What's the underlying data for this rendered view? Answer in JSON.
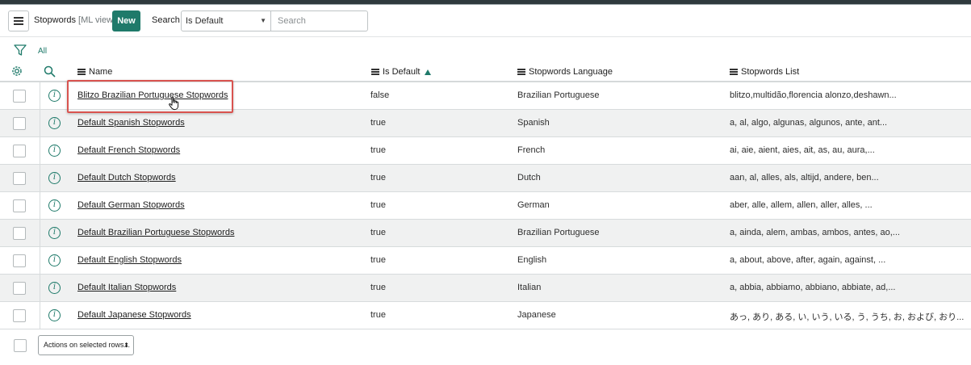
{
  "header": {
    "title": "Stopwords",
    "view": "[ML view]",
    "new_label": "New",
    "search_label": "Search",
    "search_field_selected": "Is Default",
    "search_placeholder": "Search"
  },
  "filter": {
    "label": "All"
  },
  "columns": [
    {
      "label": "Name",
      "sorted": false
    },
    {
      "label": "Is Default",
      "sorted": true,
      "sort_direction": "ascending"
    },
    {
      "label": "Stopwords Language",
      "sorted": false
    },
    {
      "label": "Stopwords List",
      "sorted": false
    }
  ],
  "rows": [
    {
      "name": "Blitzo Brazilian Portuguese Stopwords",
      "is_default": "false",
      "language": "Brazilian Portuguese",
      "list": "blitzo,multidão,florencia alonzo,deshawn..."
    },
    {
      "name": "Default Spanish Stopwords",
      "is_default": "true",
      "language": "Spanish",
      "list": "a, al, algo, algunas, algunos, ante, ant..."
    },
    {
      "name": "Default French Stopwords",
      "is_default": "true",
      "language": "French",
      "list": "ai, aie, aient, aies, ait, as, au, aura,..."
    },
    {
      "name": "Default Dutch Stopwords",
      "is_default": "true",
      "language": "Dutch",
      "list": "aan, al, alles, als, altijd, andere, ben..."
    },
    {
      "name": "Default German Stopwords",
      "is_default": "true",
      "language": "German",
      "list": "aber, alle, allem, allen, aller, alles, ..."
    },
    {
      "name": "Default Brazilian Portuguese Stopwords",
      "is_default": "true",
      "language": "Brazilian Portuguese",
      "list": "a, ainda, alem, ambas, ambos, antes, ao,..."
    },
    {
      "name": "Default English Stopwords",
      "is_default": "true",
      "language": "English",
      "list": "a, about, above, after, again, against, ..."
    },
    {
      "name": "Default Italian Stopwords",
      "is_default": "true",
      "language": "Italian",
      "list": "a, abbia, abbiamo, abbiano, abbiate, ad,..."
    },
    {
      "name": "Default Japanese Stopwords",
      "is_default": "true",
      "language": "Japanese",
      "list": "あっ, あり, ある, い, いう, いる, う, うち, お, および, おり..."
    }
  ],
  "footer": {
    "actions_label": "Actions on selected rows..."
  },
  "colors": {
    "accent": "#1f7a6a",
    "highlight": "#d9534f",
    "row_alt": "#f0f1f1"
  }
}
